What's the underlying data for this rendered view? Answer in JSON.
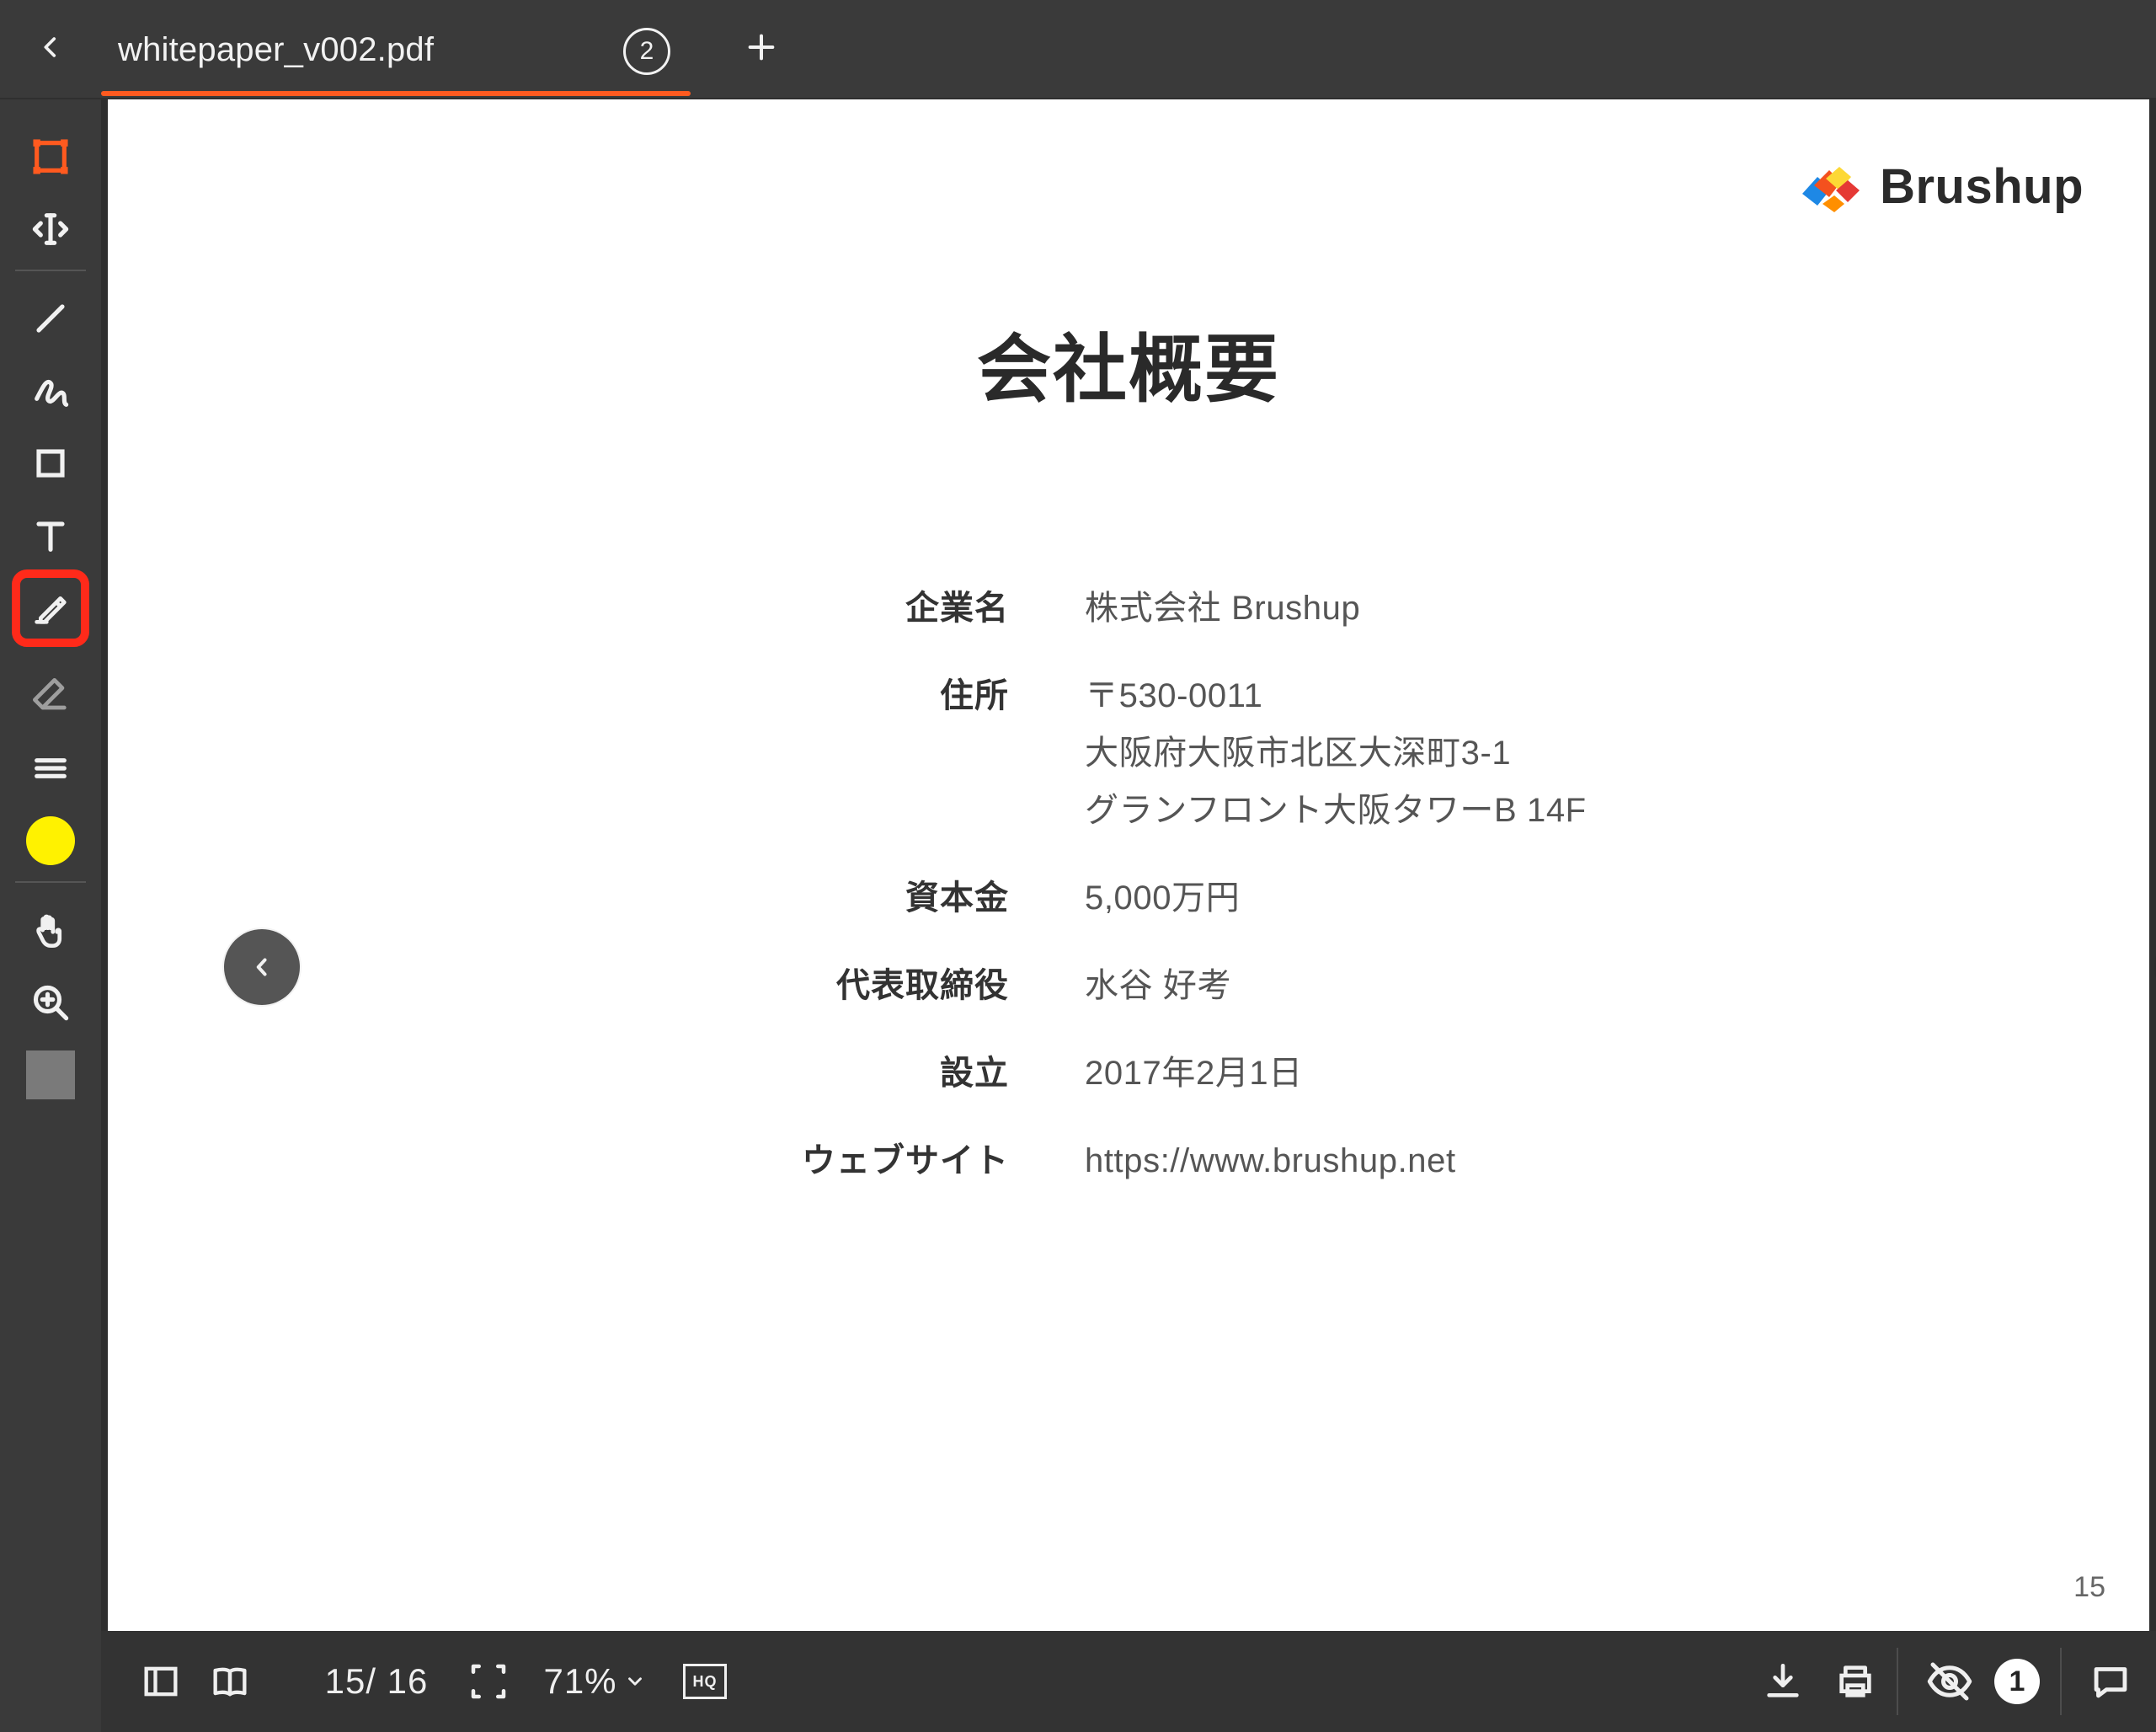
{
  "tab": {
    "title": "whitepaper_v002.pdf",
    "count": "2"
  },
  "icons": {
    "back": "chevron-left-icon",
    "add_tab": "plus-icon",
    "nav_prev": "chevron-left-icon",
    "nav_next": "chevron-right-icon"
  },
  "toolbar": {
    "selected_tool": "highlighter",
    "color": "#FFF200"
  },
  "page": {
    "logo_text": "Brushup",
    "title": "会社概要",
    "rows": [
      {
        "label": "企業名",
        "value": "株式会社 Brushup"
      },
      {
        "label": "住所",
        "lines": [
          "〒530-0011",
          "大阪府大阪市北区大深町3-1",
          "グランフロント大阪タワーB 14F"
        ]
      },
      {
        "label": "資本金",
        "value": "5,000万円"
      },
      {
        "label": "代表取締役",
        "value": "水谷 好考"
      },
      {
        "label": "設立",
        "value": "2017年2月1日"
      },
      {
        "label": "ウェブサイト",
        "value": "https://www.brushup.net"
      }
    ],
    "page_number": "15"
  },
  "bottom": {
    "page_indicator": "15/ 16",
    "zoom": "71%",
    "hq": "HQ",
    "hidden_count": "1"
  }
}
